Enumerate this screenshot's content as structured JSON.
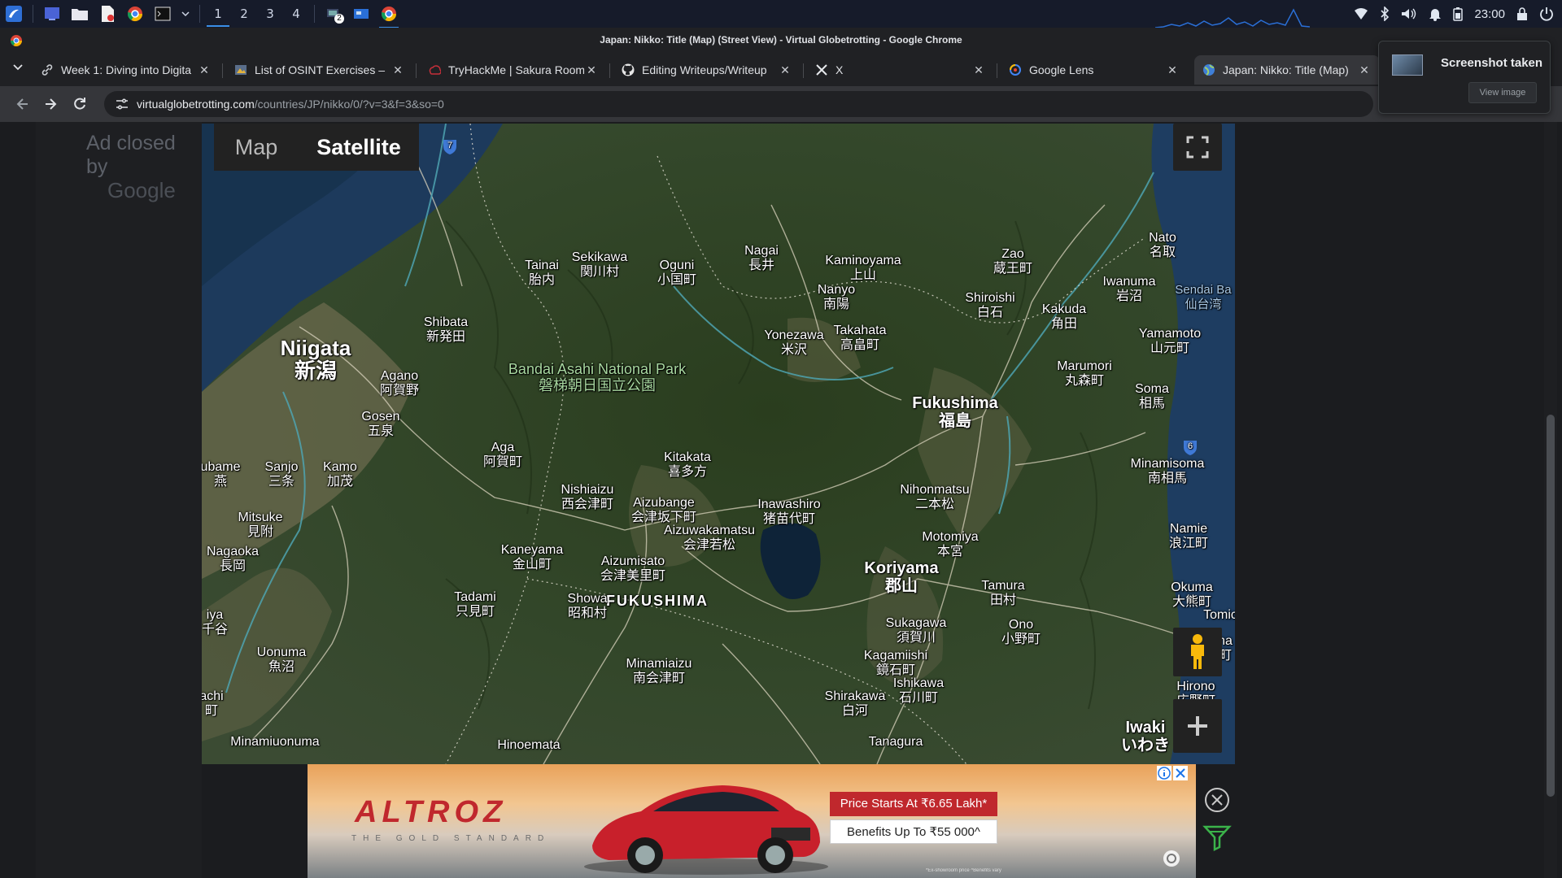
{
  "taskbar": {
    "workspaces": [
      "1",
      "2",
      "3",
      "4"
    ],
    "active_workspace": "1",
    "clock": "23:00",
    "badge": "2",
    "icons": [
      "app-menu-icon",
      "desktop-icon",
      "files-icon",
      "document-icon",
      "chrome-icon",
      "terminal-icon",
      "chevron-down-icon",
      "network-icon",
      "window-icon",
      "chrome-icon"
    ],
    "tray_icons": [
      "wifi-icon",
      "bluetooth-icon",
      "volume-icon",
      "bell-icon",
      "battery-icon",
      "lock-icon",
      "power-icon"
    ]
  },
  "window": {
    "title": "Japan: Nikko: Title (Map) (Street View) - Virtual Globetrotting - Google Chrome"
  },
  "tabs": [
    {
      "title": "Week 1: Diving into Digita",
      "icon": "link-icon"
    },
    {
      "title": "List of OSINT Exercises –",
      "icon": "osint-icon"
    },
    {
      "title": "TryHackMe | Sakura Room",
      "icon": "tryhackme-icon"
    },
    {
      "title": "Editing Writeups/Writeup",
      "icon": "github-icon"
    },
    {
      "title": "X",
      "icon": "x-icon"
    },
    {
      "title": "Google Lens",
      "icon": "lens-icon"
    },
    {
      "title": "Japan: Nikko: Title (Map)",
      "icon": "globe-icon",
      "active": true
    }
  ],
  "address": {
    "host": "virtualglobetrotting.com",
    "path": "/countries/JP/nikko/0/?v=3&f=3&so=0"
  },
  "page": {
    "ad_closed_line1": "Ad closed by",
    "ad_closed_line2": "Google"
  },
  "map": {
    "type_map": "Map",
    "type_satellite": "Satellite",
    "selected": "Satellite",
    "places": [
      {
        "key": "niigata",
        "en": "Niigata",
        "jp": "新潟",
        "size": "big"
      },
      {
        "key": "fukushima_city",
        "en": "Fukushima",
        "jp": "福島",
        "size": "mid"
      },
      {
        "key": "koriyama",
        "en": "Koriyama",
        "jp": "郡山",
        "size": "mid"
      },
      {
        "key": "iwaki",
        "en": "Iwaki",
        "jp": "いわき",
        "size": "mid"
      },
      {
        "key": "pref",
        "en": "FUKUSHIMA",
        "jp": "",
        "size": "pref"
      },
      {
        "key": "park",
        "en": "Bandai Asahi National Park",
        "jp": "磐梯朝日国立公園",
        "size": "park"
      },
      {
        "key": "sekikawa",
        "en": "Sekikawa",
        "jp": "関川村"
      },
      {
        "key": "oguni",
        "en": "Oguni",
        "jp": "小国町"
      },
      {
        "key": "tainai",
        "en": "Tainai",
        "jp": "胎内"
      },
      {
        "key": "nagai",
        "en": "Nagai",
        "jp": "長井"
      },
      {
        "key": "kaminoyama",
        "en": "Kaminoyama",
        "jp": "上山"
      },
      {
        "key": "zao",
        "en": "Zao",
        "jp": "蔵王町"
      },
      {
        "key": "natori",
        "en": "Nato",
        "jp": "名取"
      },
      {
        "key": "nanyo",
        "en": "Nanyo",
        "jp": "南陽"
      },
      {
        "key": "iwanuma",
        "en": "Iwanuma",
        "jp": "岩沼"
      },
      {
        "key": "shiroishi",
        "en": "Shiroishi",
        "jp": "白石"
      },
      {
        "key": "kakuda",
        "en": "Kakuda",
        "jp": "角田"
      },
      {
        "key": "shibata",
        "en": "Shibata",
        "jp": "新発田"
      },
      {
        "key": "yonezawa",
        "en": "Yonezawa",
        "jp": "米沢"
      },
      {
        "key": "takahata",
        "en": "Takahata",
        "jp": "高畠町"
      },
      {
        "key": "yamamoto",
        "en": "Yamamoto",
        "jp": "山元町"
      },
      {
        "key": "agano",
        "en": "Agano",
        "jp": "阿賀野"
      },
      {
        "key": "marumori",
        "en": "Marumori",
        "jp": "丸森町"
      },
      {
        "key": "soma",
        "en": "Soma",
        "jp": "相馬"
      },
      {
        "key": "gosen",
        "en": "Gosen",
        "jp": "五泉"
      },
      {
        "key": "aga",
        "en": "Aga",
        "jp": "阿賀町"
      },
      {
        "key": "kitakata",
        "en": "Kitakata",
        "jp": "喜多方"
      },
      {
        "key": "tsubame",
        "en": "ubame",
        "jp": "燕"
      },
      {
        "key": "sanjo",
        "en": "Sanjo",
        "jp": "三条"
      },
      {
        "key": "kamo",
        "en": "Kamo",
        "jp": "加茂"
      },
      {
        "key": "minamisoma",
        "en": "Minamisoma",
        "jp": "南相馬"
      },
      {
        "key": "nishiaizu",
        "en": "Nishiaizu",
        "jp": "西会津町"
      },
      {
        "key": "aizubange",
        "en": "Aizubange",
        "jp": "会津坂下町"
      },
      {
        "key": "inawashiro",
        "en": "Inawashiro",
        "jp": "猪苗代町"
      },
      {
        "key": "nihonmatsu",
        "en": "Nihonmatsu",
        "jp": "二本松"
      },
      {
        "key": "mitsuke",
        "en": "Mitsuke",
        "jp": "見附"
      },
      {
        "key": "aizuwakamatsu",
        "en": "Aizuwakamatsu",
        "jp": "会津若松"
      },
      {
        "key": "namie",
        "en": "Namie",
        "jp": "浪江町"
      },
      {
        "key": "motomiya",
        "en": "Motomiya",
        "jp": "本宮"
      },
      {
        "key": "nagaoka",
        "en": "Nagaoka",
        "jp": "長岡"
      },
      {
        "key": "kaneyama",
        "en": "Kaneyama",
        "jp": "金山町"
      },
      {
        "key": "aizumisato",
        "en": "Aizumisato",
        "jp": "会津美里町"
      },
      {
        "key": "okuma",
        "en": "Okuma",
        "jp": "大熊町"
      },
      {
        "key": "tadami",
        "en": "Tadami",
        "jp": "只見町"
      },
      {
        "key": "showa",
        "en": "Showa",
        "jp": "昭和村"
      },
      {
        "key": "tamura",
        "en": "Tamura",
        "jp": "田村"
      },
      {
        "key": "ojiya",
        "en": "iya",
        "jp": "千谷"
      },
      {
        "key": "tomioka",
        "en": "Tomic",
        "jp": ""
      },
      {
        "key": "sukagawa",
        "en": "Sukagawa",
        "jp": "須賀川"
      },
      {
        "key": "ono",
        "en": "Ono",
        "jp": "小野町"
      },
      {
        "key": "naraha",
        "en": "na",
        "jp": "町"
      },
      {
        "key": "uonuma",
        "en": "Uonuma",
        "jp": "魚沼"
      },
      {
        "key": "kagamiishi",
        "en": "Kagamiishi",
        "jp": "鏡石町"
      },
      {
        "key": "minamiaizu",
        "en": "Minamiaizu",
        "jp": "南会津町"
      },
      {
        "key": "ishikawa",
        "en": "Ishikawa",
        "jp": "石川町"
      },
      {
        "key": "hirono",
        "en": "Hirono",
        "jp": "広野町"
      },
      {
        "key": "machi",
        "en": "achi",
        "jp": "町"
      },
      {
        "key": "shirakawa",
        "en": "Shirakawa",
        "jp": "白河"
      },
      {
        "key": "minamiuonuma",
        "en": "Minamiuonuma",
        "jp": ""
      },
      {
        "key": "hinoemata",
        "en": "Hinoemata",
        "jp": ""
      },
      {
        "key": "tanagura",
        "en": "Tanagura",
        "jp": ""
      },
      {
        "key": "sendai_bay",
        "en": "Sendai Ba",
        "jp": "仙台湾",
        "size": "sea"
      }
    ],
    "route_shields": [
      "7",
      "6"
    ]
  },
  "ad": {
    "brand": "ALTROZ",
    "tagline": "THE GOLD STANDARD",
    "price": "Price Starts At ₹6.65 Lakh*",
    "benefits": "Benefits Up To ₹55 000^",
    "fineprint": "*Ex-showroom price  ^Benefits vary"
  },
  "notification": {
    "title": "Screenshot taken",
    "button": "View image"
  }
}
